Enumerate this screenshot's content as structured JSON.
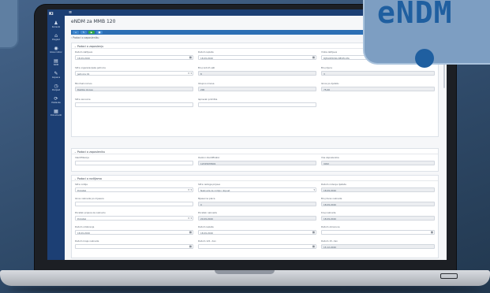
{
  "brand": {
    "name": "eNDM"
  },
  "sidebar": {
    "logo": "Ki",
    "items": [
      {
        "icon": "♟",
        "label": "Korisnik"
      },
      {
        "icon": "⌂",
        "label": "Pregled"
      },
      {
        "icon": "◉",
        "label": "Glavni izbor"
      },
      {
        "icon": "▤",
        "label": "NDM"
      },
      {
        "icon": "✎",
        "label": "Izvjesca"
      },
      {
        "icon": "◷",
        "label": "Povijest"
      },
      {
        "icon": "⟳",
        "label": "Postavke"
      },
      {
        "icon": "▦",
        "label": "Dokumenti"
      }
    ]
  },
  "topbar": {
    "menu_icon": "≡"
  },
  "page": {
    "title": "eNDM za MMB 120",
    "subtitle": "",
    "breadcrumb": "Podaci o zaposleniku"
  },
  "toolbar": {
    "buttons": [
      {
        "label": "+",
        "color": "#3f88d0"
      },
      {
        "label": "✎",
        "color": "#3f88d0"
      },
      {
        "label": "▶",
        "color": "#2ea84a"
      },
      {
        "label": "■",
        "color": "#3f88d0"
      }
    ]
  },
  "sections": {
    "s1": {
      "title": "Podaci o zaposlenju",
      "fields": [
        {
          "label": "Datum zahtjeva",
          "value": "18.09.2020",
          "kind": "date"
        },
        {
          "label": "Datum isplate",
          "value": "18.09.2020",
          "kind": "date"
        },
        {
          "label": "Vrsta zahtjeva",
          "value": "DJELOMICNA NEUPLATA",
          "kind": "select"
        },
        {
          "label": "Sifra organizacijske jedinice",
          "value": "Jedinica 01",
          "kind": "select"
        },
        {
          "label": "Broj radnih sati",
          "value": "8",
          "kind": "ro"
        },
        {
          "label": "Broj djece",
          "value": "3",
          "kind": "ro"
        },
        {
          "label": "Minimalni iznos",
          "value": "Razlika iznosa",
          "kind": "ro"
        },
        {
          "label": "Ukupno iznosa",
          "value": "200",
          "kind": "ro"
        },
        {
          "label": "Iznos po djetetu",
          "value": "75,00",
          "kind": "ro"
        },
        {
          "label": "Sifra osnovice",
          "value": "",
          "kind": "text"
        },
        {
          "label": "Ispravak primitka",
          "value": "",
          "kind": "text"
        }
      ]
    },
    "s2": {
      "title": "Podaci o zaposleniku",
      "fields": [
        {
          "label": "Identifikacija",
          "value": "",
          "kind": "text"
        },
        {
          "label": "Osobni identifikator",
          "value": "12345678901",
          "kind": "ro"
        },
        {
          "label": "Ime zaposlenika",
          "value": "IVAN",
          "kind": "ro"
        }
      ]
    },
    "s3": {
      "title": "Podaci o rodiljama",
      "fields": [
        {
          "label": "Sifra rodilje",
          "value": "Podatak",
          "kind": "select"
        },
        {
          "label": "Sifra razloga prijave",
          "value": "Naknada za rodiljni dopust",
          "kind": "select"
        },
        {
          "label": "Datum rodenja djeteta",
          "value": "18.09.2020",
          "kind": "ro"
        },
        {
          "label": "Iznos naknade po mjesecu",
          "value": "",
          "kind": "text"
        },
        {
          "label": "Mjesecna placa",
          "value": "0",
          "kind": "ro"
        },
        {
          "label": "Broj dana naknade",
          "value": "18.09.2020",
          "kind": "ro"
        },
        {
          "label": "Pocetak prijava za naknadu",
          "value": "Podatak",
          "kind": "select"
        },
        {
          "label": "Pocetak naknade",
          "value": "20.09.2020",
          "kind": "ro"
        },
        {
          "label": "Kraj naknade",
          "value": "18.09.2020",
          "kind": "ro"
        },
        {
          "label": "Datum odobrenja",
          "value": "18.09.2020",
          "kind": "date"
        },
        {
          "label": "Datum isplate",
          "value": "18.09.2020",
          "kind": "date"
        },
        {
          "label": "Datum obracuna",
          "value": "",
          "kind": "date"
        },
        {
          "label": "Datum kraja naknade",
          "value": "",
          "kind": "date"
        },
        {
          "label": "Datum 121. dan",
          "value": "",
          "kind": "date"
        },
        {
          "label": "Datum 15. dan",
          "value": "15.12.2020",
          "kind": "ro"
        }
      ]
    }
  }
}
